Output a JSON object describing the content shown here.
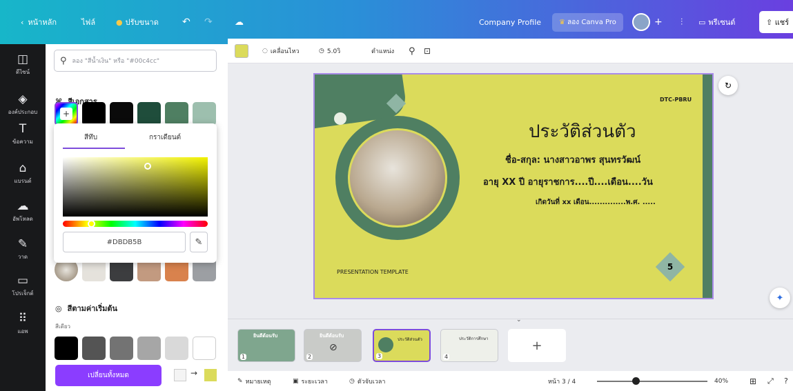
{
  "topbar": {
    "home": "หน้าหลัก",
    "file": "ไฟล์",
    "resize": "ปรับขนาด",
    "project_name": "Company Profile",
    "try_pro": "ลอง Canva Pro",
    "present": "พรีเซนต์",
    "share": "แชร์"
  },
  "rail": {
    "items": [
      {
        "label": "ดีไซน์",
        "icon": "layout-icon"
      },
      {
        "label": "องค์ประกอบ",
        "icon": "elements-icon"
      },
      {
        "label": "ข้อความ",
        "icon": "text-icon"
      },
      {
        "label": "แบรนด์",
        "icon": "brand-icon"
      },
      {
        "label": "อัพโหลด",
        "icon": "upload-icon"
      },
      {
        "label": "วาด",
        "icon": "draw-icon"
      },
      {
        "label": "โปรเจ็กต์",
        "icon": "folder-icon"
      },
      {
        "label": "แอพ",
        "icon": "apps-icon"
      }
    ]
  },
  "panel": {
    "search_placeholder": "ลอง \"สีน้ำเงิน\" หรือ \"#00c4cc\"",
    "doc_colors_title": "สีเอกสาร",
    "doc_colors": [
      "#000000",
      "#0a0a0a",
      "#1f4d3b",
      "#4f7f62",
      "#9dbfae"
    ],
    "picker": {
      "tab_solid": "สีทึบ",
      "tab_gradient": "กราเดียนต์",
      "hex_value": "#DBDB5B"
    },
    "photo_colors": [
      "#e5e2dc",
      "#3c3d3f",
      "#c29a80",
      "#d9824d",
      "#9c9fa3"
    ],
    "default_colors_title": "สีตามค่าเริ่มต้น",
    "solid_label": "สีเดียว",
    "default_colors": [
      "#000000",
      "#545454",
      "#737373",
      "#a6a6a6",
      "#d9d9d9",
      "#ffffff"
    ],
    "change_all": "เปลี่ยนทั้งหมด"
  },
  "ctoolbar": {
    "animate": "เคลื่อนไหว",
    "duration": "5.0วิ",
    "position": "ตำแหน่ง"
  },
  "slide": {
    "brand": "DTC-PBRU",
    "title": "ประวัติส่วนตัว",
    "name_line": "ชื่อ-สกุล: นางสาวอาพร สุนทรวัฒน์",
    "age_line": "อายุ  XX  ปี อายุราชการ....ปี....เดือน....วัน",
    "born_line": "เกิดวันที่ xx เดือน..............พ.ศ. .....",
    "template_label": "PRESENTATION TEMPLATE",
    "page_number": "5",
    "bg_color": "#dbdb5b",
    "accent_color": "#4f7f62"
  },
  "filmstrip": {
    "pages": [
      {
        "num": "1",
        "caption": "ยินดีต้อนรับ"
      },
      {
        "num": "2",
        "caption": "ยินดีต้อนรับ"
      },
      {
        "num": "3",
        "caption": "ประวัติส่วนตัว"
      },
      {
        "num": "4",
        "caption": "ประวัติการศึกษา"
      }
    ]
  },
  "bottombar": {
    "notes": "หมายเหตุ",
    "duration": "ระยะเวลา",
    "timer": "ตัวจับเวลา",
    "page_indicator": "หน้า 3 / 4",
    "zoom": "40%"
  }
}
